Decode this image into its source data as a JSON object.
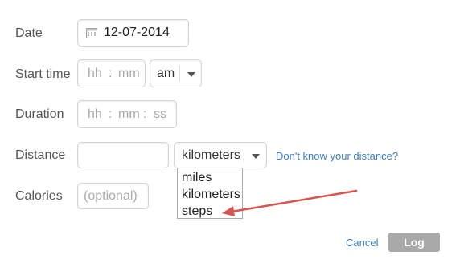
{
  "form": {
    "date": {
      "label": "Date",
      "value": "12-07-2014"
    },
    "start_time": {
      "label": "Start time",
      "hour_placeholder": "hh",
      "minute_placeholder": "mm",
      "separator": ":",
      "ampm_value": "am"
    },
    "duration": {
      "label": "Duration",
      "hour_placeholder": "hh",
      "minute_placeholder": "mm",
      "second_placeholder": "ss",
      "separator": ":"
    },
    "distance": {
      "label": "Distance",
      "value": "",
      "unit_value": "kilometers",
      "help_link": "Don't know your distance?",
      "unit_options": [
        "miles",
        "kilometers",
        "steps"
      ]
    },
    "calories": {
      "label": "Calories",
      "placeholder": "(optional)"
    }
  },
  "actions": {
    "cancel_label": "Cancel",
    "log_label": "Log"
  },
  "annotation": {
    "arrow_color": "#d9534f"
  },
  "colors": {
    "link": "#3a7fc6",
    "log_button": "#a9a9a9"
  }
}
